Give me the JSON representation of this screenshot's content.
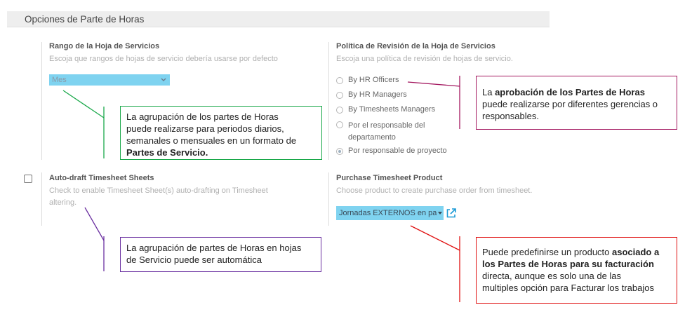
{
  "section": {
    "title": "Opciones de Parte de Horas"
  },
  "range": {
    "title": "Rango de la Hoja de Servicios",
    "description": "Escoja que rangos de hojas de servicio debería usarse por defecto",
    "select_value": "Mes"
  },
  "policy": {
    "title": "Política de Revisión de la Hoja de Servicios",
    "description": "Escoja una política de revisión de hojas de servicio.",
    "options": [
      {
        "label": "By HR Officers",
        "checked": false
      },
      {
        "label": "By HR Managers",
        "checked": false
      },
      {
        "label": "By Timesheets Managers",
        "checked": false
      },
      {
        "label_line1": "Por el responsable del",
        "label_line2": "departamento",
        "checked": false
      },
      {
        "label": "Por responsable de proyecto",
        "checked": true
      }
    ]
  },
  "autodraft": {
    "title": "Auto-draft Timesheet Sheets",
    "description_line1": "Check to enable Timesheet Sheet(s) auto-drafting on Timesheet",
    "description_line2": "altering.",
    "checked": false
  },
  "purchase": {
    "title": "Purchase Timesheet Product",
    "description": "Choose product to create purchase order from timesheet.",
    "product_value": "Jornadas EXTERNOS en par"
  },
  "callouts": {
    "green": {
      "line1": "La agrupación de los partes de Horas",
      "line2": "puede realizarse para periodos diarios,",
      "line3": "semanales o mensuales en un formato de",
      "bold": "Partes de Servicio."
    },
    "magenta": {
      "pre": "La ",
      "bold": "aprobación de los Partes de Horas",
      "line2": "puede realizarse por diferentes gerencias o",
      "line3": "responsables."
    },
    "purple": {
      "line1": "La agrupación de partes de Horas en hojas",
      "line2": "de Servicio puede ser automática"
    },
    "red": {
      "pre": "Puede predefinirse un producto ",
      "bold1": "asociado a",
      "bold2": "los Partes de Horas para su facturación",
      "line3": "directa, aunque es solo una de las",
      "line4": "multiples opción para Facturar los trabajos"
    }
  },
  "colors": {
    "green": "#1aa84a",
    "magenta": "#a3175f",
    "purple": "#6a2fa0",
    "red": "#e01010",
    "select_bg": "#7fd3f0"
  },
  "icons": {
    "external_link": "external-link-icon",
    "dropdown": "chevron-down-icon"
  }
}
